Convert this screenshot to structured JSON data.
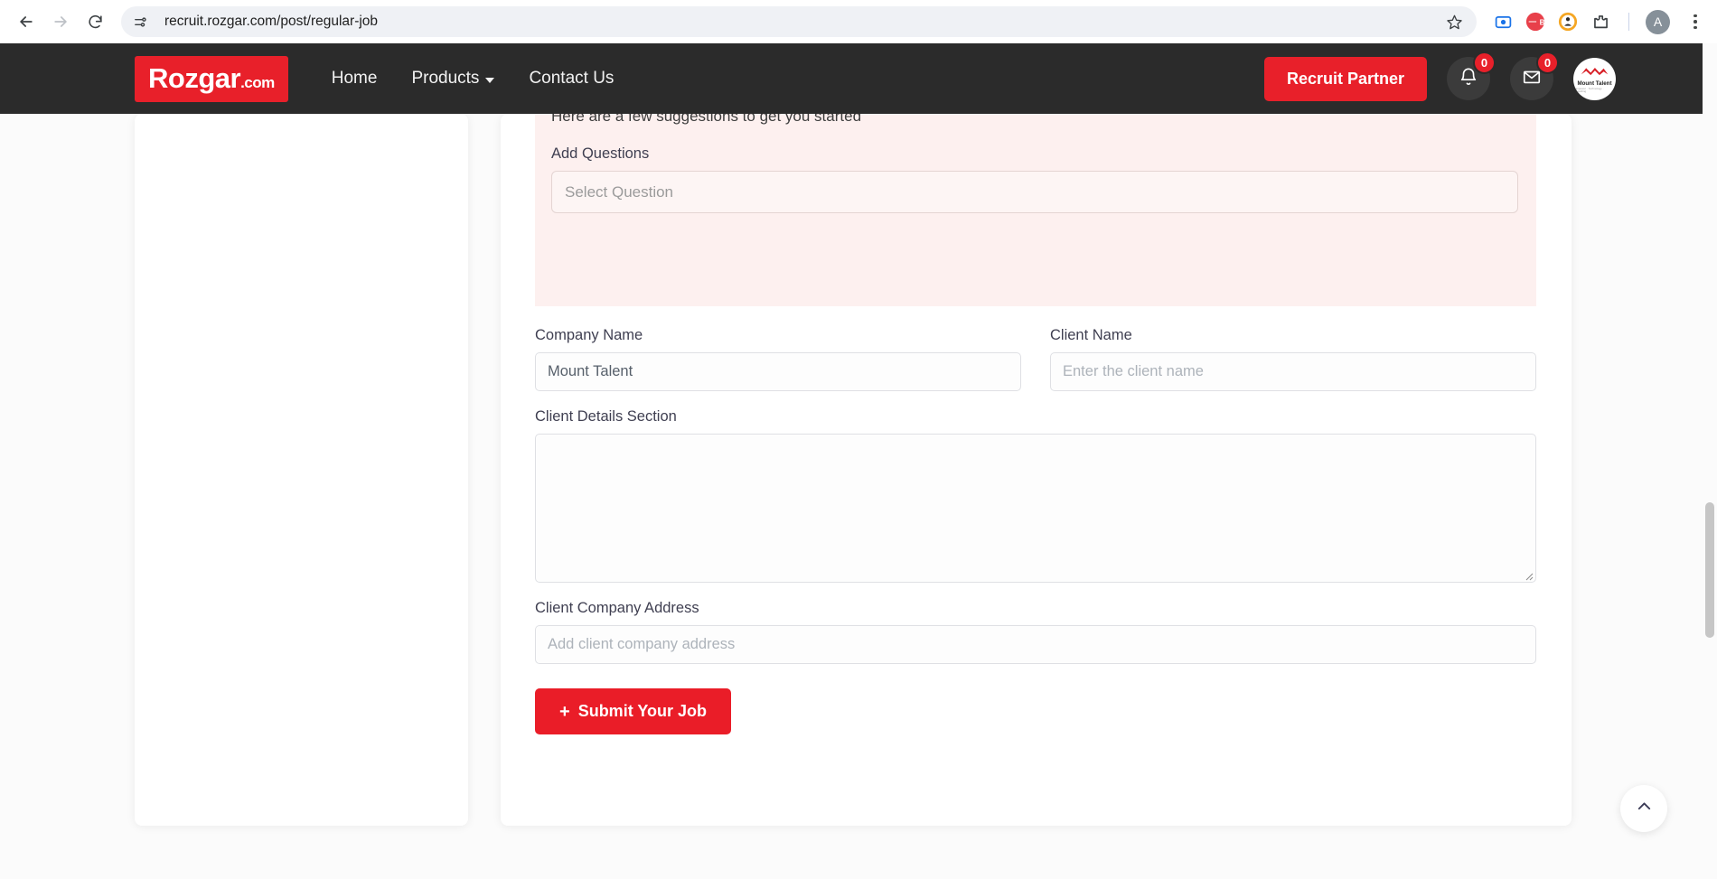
{
  "browser": {
    "url": "recruit.rozgar.com/post/regular-job",
    "back_icon": "back-arrow-icon",
    "forward_icon": "forward-arrow-icon",
    "reload_icon": "reload-icon",
    "site_settings_icon": "tune-sliders-icon",
    "bookmark_icon": "star-icon",
    "extensions": [
      {
        "name": "screen-recorder-extension-icon",
        "color": "#1a73e8"
      },
      {
        "name": "brand-b-extension-icon",
        "color": "#e8404a"
      },
      {
        "name": "orange-avatar-extension-icon",
        "color": "#f5a623"
      },
      {
        "name": "extensions-puzzle-icon",
        "color": "#3c4043"
      }
    ],
    "profile_initial": "A",
    "menu_icon": "kebab-menu-icon"
  },
  "site_header": {
    "logo_main": "Rozgar",
    "logo_suffix": ".com",
    "nav": [
      {
        "label": "Home",
        "has_chevron": false
      },
      {
        "label": "Products",
        "has_chevron": true
      },
      {
        "label": "Contact Us",
        "has_chevron": false
      }
    ],
    "recruit_partner_label": "Recruit Partner",
    "notification_badge": "0",
    "message_badge": "0",
    "avatar_name": "Mount Talent",
    "avatar_tagline": "Manpower · Technology · Consulting",
    "bg_color": "#2b2b2b",
    "accent_color": "#e8202a"
  },
  "form": {
    "suggestion_lead": "Here are a few suggestions to get you started",
    "add_questions_label": "Add Questions",
    "select_question_placeholder": "Select Question",
    "company_name_label": "Company Name",
    "company_name_value": "Mount Talent",
    "client_name_label": "Client Name",
    "client_name_placeholder": "Enter the client name",
    "client_details_label": "Client Details Section",
    "client_details_value": "",
    "client_address_label": "Client Company Address",
    "client_address_placeholder": "Add client company address",
    "submit_plus": "+",
    "submit_label": "Submit Your Job",
    "panel_bg": "#fdf0ef",
    "submit_color": "#ea1d28"
  },
  "widgets": {
    "scroll_top_icon": "chevron-up-icon"
  }
}
